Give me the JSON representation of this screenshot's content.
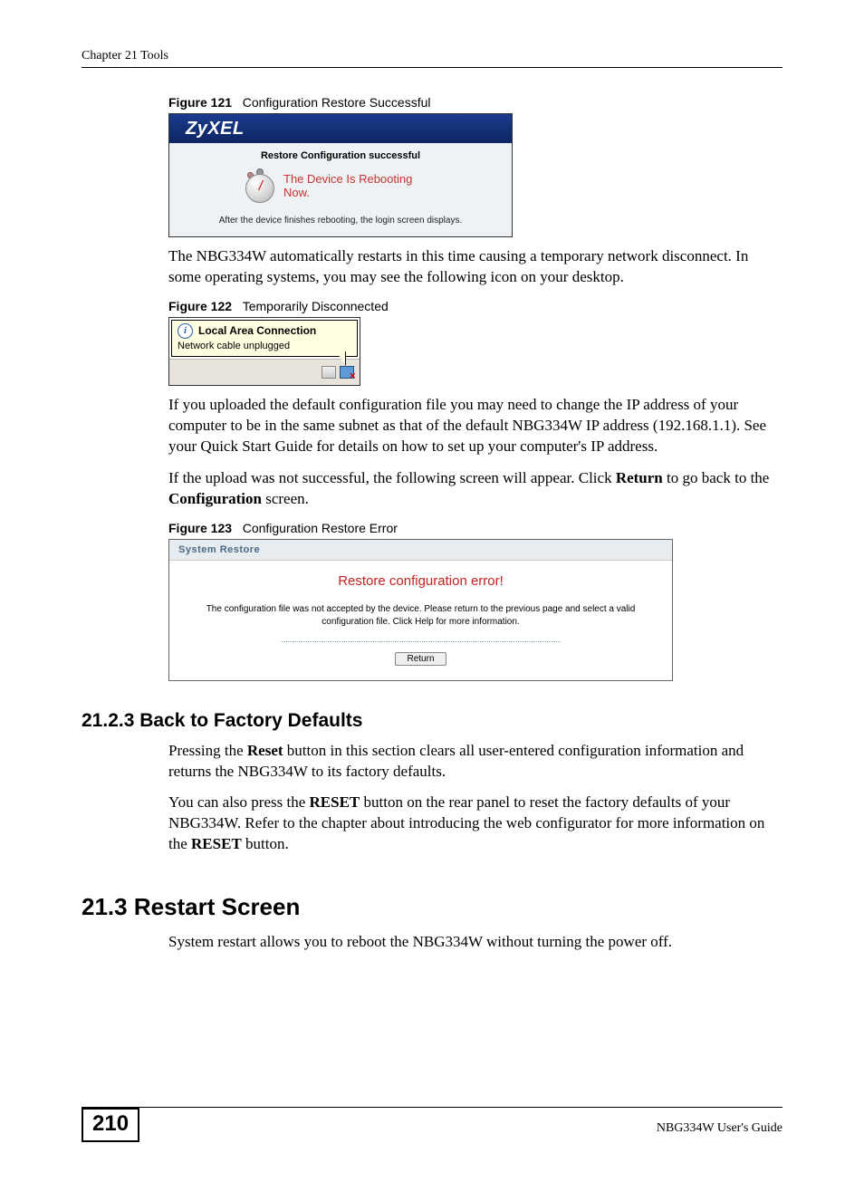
{
  "header": {
    "running": "Chapter 21 Tools"
  },
  "fig121": {
    "caption_label": "Figure 121",
    "caption_text": "Configuration Restore Successful",
    "brand": "ZyXEL",
    "title": "Restore Configuration successful",
    "reboot": "The Device Is Rebooting Now.",
    "footer": "After the device finishes rebooting, the login screen displays."
  },
  "para1": "The NBG334W automatically restarts in this time causing a temporary network disconnect. In some operating systems, you may see the following icon on your desktop.",
  "fig122": {
    "caption_label": "Figure 122",
    "caption_text": "Temporarily Disconnected",
    "balloon_title": "Local Area Connection",
    "balloon_sub": "Network cable unplugged"
  },
  "para2": "If you uploaded the default configuration file you may need to change the IP address of your computer to be in the same subnet as that of the default NBG334W IP address (192.168.1.1). See your Quick Start Guide for details on how to set up your computer's IP address.",
  "para3_a": "If the upload was not successful, the following screen will appear. Click ",
  "para3_b": "Return",
  "para3_c": " to go back to the ",
  "para3_d": "Configuration",
  "para3_e": " screen.",
  "fig123": {
    "caption_label": "Figure 123",
    "caption_text": "Configuration Restore Error",
    "header": "System Restore",
    "error": "Restore configuration error!",
    "message": "The configuration file was not accepted by the device. Please return to the previous page and select a valid configuration file. Click Help for more information.",
    "button": "Return"
  },
  "sec2123": {
    "heading": "21.2.3  Back to Factory Defaults",
    "p1_a": "Pressing the ",
    "p1_b": "Reset",
    "p1_c": " button in this section clears all user-entered configuration information and returns the NBG334W to its factory defaults.",
    "p2_a": "You can also press the ",
    "p2_b": "RESET",
    "p2_c": " button on the rear panel to reset the factory defaults of your NBG334W. Refer to the chapter about introducing the web configurator for more information on the ",
    "p2_d": "RESET",
    "p2_e": " button."
  },
  "sec213": {
    "heading": "21.3  Restart Screen",
    "p1": "System restart allows you to reboot the NBG334W without turning the power off."
  },
  "footer": {
    "page": "210",
    "guide": "NBG334W User's Guide"
  }
}
